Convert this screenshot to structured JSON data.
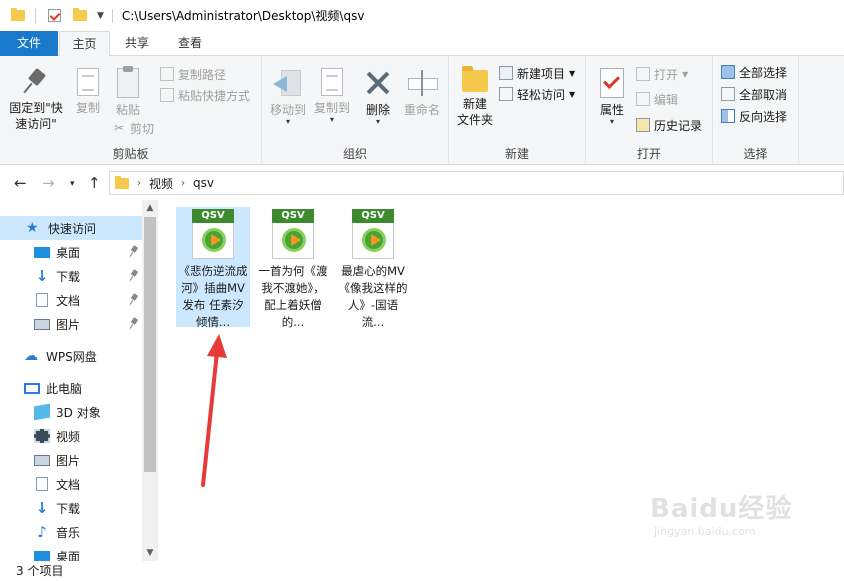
{
  "titlebar": {
    "path": "C:\\Users\\Administrator\\Desktop\\视频\\qsv"
  },
  "tabs": {
    "file": "文件",
    "home": "主页",
    "share": "共享",
    "view": "查看"
  },
  "ribbon": {
    "clipboard": {
      "pin_label_1": "固定到\"快",
      "pin_label_2": "速访问\"",
      "copy": "复制",
      "paste": "粘贴",
      "copy_path": "复制路径",
      "paste_shortcut": "粘贴快捷方式",
      "cut": "剪切",
      "group": "剪贴板"
    },
    "organize": {
      "move_to": "移动到",
      "copy_to": "复制到",
      "delete": "删除",
      "rename": "重命名",
      "group": "组织"
    },
    "new": {
      "new_folder_1": "新建",
      "new_folder_2": "文件夹",
      "new_item": "新建项目",
      "easy_access": "轻松访问",
      "group": "新建"
    },
    "open": {
      "properties": "属性",
      "open": "打开",
      "edit": "编辑",
      "history": "历史记录",
      "group": "打开"
    },
    "select": {
      "select_all": "全部选择",
      "select_none": "全部取消",
      "invert": "反向选择",
      "group": "选择"
    }
  },
  "address": {
    "crumbs": [
      "视频",
      "qsv"
    ]
  },
  "nav": {
    "quick_access": "快速访问",
    "desktop": "桌面",
    "downloads": "下载",
    "documents": "文档",
    "pictures": "图片",
    "wps": "WPS网盘",
    "this_pc": "此电脑",
    "objects3d": "3D 对象",
    "videos": "视频",
    "pictures2": "图片",
    "documents2": "文档",
    "downloads2": "下载",
    "music": "音乐",
    "desktop2": "桌面"
  },
  "files": [
    {
      "badge": "QSV",
      "name": "《悲伤逆流成河》插曲MV发布 任素汐倾情..."
    },
    {
      "badge": "QSV",
      "name": "一首为何《渡我不渡她》，配上着妖僧的..."
    },
    {
      "badge": "QSV",
      "name": "最虐心的MV《像我这样的人》-国语流..."
    }
  ],
  "status": {
    "count": "3 个项目"
  },
  "watermark": {
    "main": "Baidu经验",
    "sub": "jingyan.baidu.com"
  },
  "colors": {
    "accent": "#1979ca",
    "selection": "#cce8ff",
    "arrow": "#e83a3a"
  }
}
